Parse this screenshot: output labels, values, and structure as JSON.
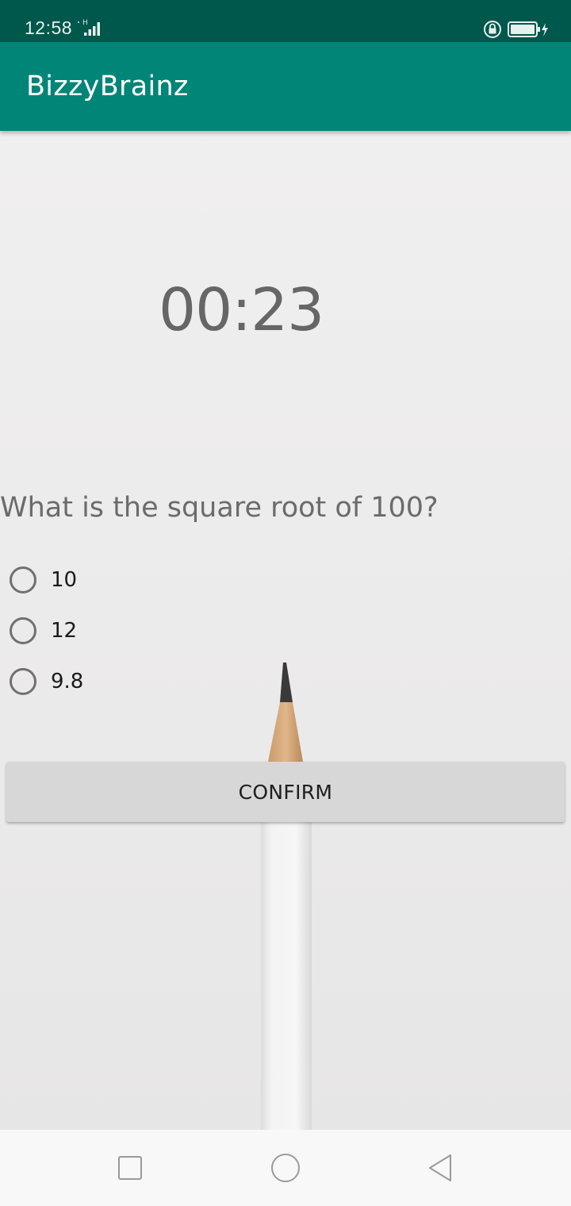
{
  "status_bar": {
    "time": "12:58",
    "network_type": "H",
    "icons": [
      "signal-icon",
      "vpn-lock-icon",
      "battery-charging-icon"
    ]
  },
  "app_bar": {
    "title": "BizzyBrainz",
    "color": "#008577",
    "status_color": "#00574b"
  },
  "quiz": {
    "timer": "00:23",
    "question": "What is the square root of 100?",
    "options": [
      {
        "label": "10",
        "selected": false
      },
      {
        "label": "12",
        "selected": false
      },
      {
        "label": "9.8",
        "selected": false
      }
    ],
    "confirm_label": "CONFIRM"
  },
  "nav_bar": {
    "icons": [
      "recents-square-icon",
      "home-circle-icon",
      "back-triangle-icon"
    ]
  }
}
